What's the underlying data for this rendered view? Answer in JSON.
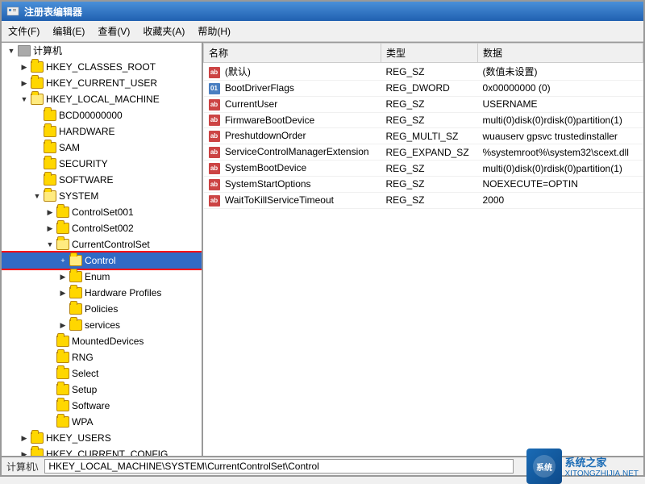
{
  "window": {
    "title": "注册表编辑器"
  },
  "menu": {
    "items": [
      {
        "label": "文件(F)"
      },
      {
        "label": "编辑(E)"
      },
      {
        "label": "查看(V)"
      },
      {
        "label": "收藏夹(A)"
      },
      {
        "label": "帮助(H)"
      }
    ]
  },
  "tree": {
    "items": [
      {
        "id": "computer",
        "label": "计算机",
        "indent": "indent1",
        "expanded": true,
        "hasChildren": true,
        "type": "computer"
      },
      {
        "id": "classes_root",
        "label": "HKEY_CLASSES_ROOT",
        "indent": "indent2",
        "expanded": false,
        "hasChildren": true
      },
      {
        "id": "current_user",
        "label": "HKEY_CURRENT_USER",
        "indent": "indent2",
        "expanded": false,
        "hasChildren": true
      },
      {
        "id": "local_machine",
        "label": "HKEY_LOCAL_MACHINE",
        "indent": "indent2",
        "expanded": true,
        "hasChildren": true
      },
      {
        "id": "bcd",
        "label": "BCD00000000",
        "indent": "indent3",
        "expanded": false,
        "hasChildren": false
      },
      {
        "id": "hardware",
        "label": "HARDWARE",
        "indent": "indent3",
        "expanded": false,
        "hasChildren": false
      },
      {
        "id": "sam",
        "label": "SAM",
        "indent": "indent3",
        "expanded": false,
        "hasChildren": false
      },
      {
        "id": "security",
        "label": "SECURITY",
        "indent": "indent3",
        "expanded": false,
        "hasChildren": false
      },
      {
        "id": "software",
        "label": "SOFTWARE",
        "indent": "indent3",
        "expanded": false,
        "hasChildren": false
      },
      {
        "id": "system",
        "label": "SYSTEM",
        "indent": "indent3",
        "expanded": true,
        "hasChildren": true
      },
      {
        "id": "controlset001",
        "label": "ControlSet001",
        "indent": "indent4",
        "expanded": false,
        "hasChildren": true
      },
      {
        "id": "controlset002",
        "label": "ControlSet002",
        "indent": "indent4",
        "expanded": false,
        "hasChildren": true
      },
      {
        "id": "currentcontrolset",
        "label": "CurrentControlSet",
        "indent": "indent4",
        "expanded": true,
        "hasChildren": true
      },
      {
        "id": "control",
        "label": "Control",
        "indent": "indent5",
        "expanded": true,
        "hasChildren": true,
        "selected": true,
        "highlighted": true
      },
      {
        "id": "enum",
        "label": "Enum",
        "indent": "indent5",
        "expanded": false,
        "hasChildren": true
      },
      {
        "id": "hardware_profiles",
        "label": "Hardware Profiles",
        "indent": "indent5",
        "expanded": false,
        "hasChildren": true
      },
      {
        "id": "policies",
        "label": "Policies",
        "indent": "indent5",
        "expanded": false,
        "hasChildren": false
      },
      {
        "id": "services",
        "label": "services",
        "indent": "indent5",
        "expanded": false,
        "hasChildren": true
      },
      {
        "id": "mounteddevices",
        "label": "MountedDevices",
        "indent": "indent4",
        "expanded": false,
        "hasChildren": false
      },
      {
        "id": "rng",
        "label": "RNG",
        "indent": "indent4",
        "expanded": false,
        "hasChildren": false
      },
      {
        "id": "select",
        "label": "Select",
        "indent": "indent4",
        "expanded": false,
        "hasChildren": false
      },
      {
        "id": "setup",
        "label": "Setup",
        "indent": "indent4",
        "expanded": false,
        "hasChildren": false
      },
      {
        "id": "software2",
        "label": "Software",
        "indent": "indent4",
        "expanded": false,
        "hasChildren": false
      },
      {
        "id": "wpa",
        "label": "WPA",
        "indent": "indent4",
        "expanded": false,
        "hasChildren": false
      },
      {
        "id": "hkey_users",
        "label": "HKEY_USERS",
        "indent": "indent2",
        "expanded": false,
        "hasChildren": true
      },
      {
        "id": "hkey_current_config",
        "label": "HKEY_CURRENT_CONFIG",
        "indent": "indent2",
        "expanded": false,
        "hasChildren": true
      }
    ]
  },
  "table": {
    "columns": [
      {
        "label": "名称"
      },
      {
        "label": "类型"
      },
      {
        "label": "数据"
      }
    ],
    "rows": [
      {
        "name": "(默认)",
        "type": "REG_SZ",
        "data": "(数值未设置)",
        "icon": "ab"
      },
      {
        "name": "BootDriverFlags",
        "type": "REG_DWORD",
        "data": "0x00000000 (0)",
        "icon": "du"
      },
      {
        "name": "CurrentUser",
        "type": "REG_SZ",
        "data": "USERNAME",
        "icon": "ab"
      },
      {
        "name": "FirmwareBootDevice",
        "type": "REG_SZ",
        "data": "multi(0)disk(0)rdisk(0)partition(1)",
        "icon": "ab"
      },
      {
        "name": "PreshutdownOrder",
        "type": "REG_MULTI_SZ",
        "data": "wuauserv gpsvc trustedinstaller",
        "icon": "ab"
      },
      {
        "name": "ServiceControlManagerExtension",
        "type": "REG_EXPAND_SZ",
        "data": "%systemroot%\\system32\\scext.dll",
        "icon": "ab"
      },
      {
        "name": "SystemBootDevice",
        "type": "REG_SZ",
        "data": "multi(0)disk(0)rdisk(0)partition(1)",
        "icon": "ab"
      },
      {
        "name": "SystemStartOptions",
        "type": "REG_SZ",
        "data": " NOEXECUTE=OPTIN",
        "icon": "ab"
      },
      {
        "name": "WaitToKillServiceTimeout",
        "type": "REG_SZ",
        "data": "2000",
        "icon": "ab"
      }
    ]
  },
  "status_bar": {
    "label": "计算机\\",
    "path": "HKEY_LOCAL_MACHINE\\SYSTEM\\CurrentControlSet\\Control"
  },
  "watermark": {
    "site": "系统之家",
    "url": "XITONGZHIJIA.NET"
  }
}
